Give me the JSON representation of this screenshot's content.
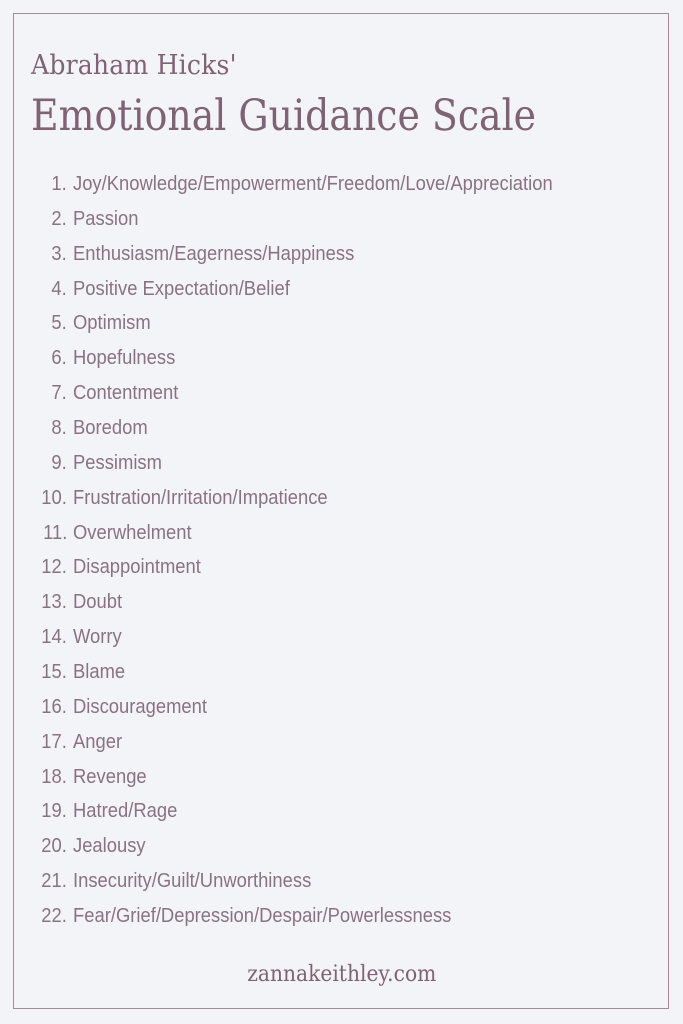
{
  "header": {
    "subtitle": "Abraham Hicks'",
    "title": "Emotional Guidance Scale"
  },
  "scale": {
    "items": [
      {
        "number": "1.",
        "label": "Joy/Knowledge/Empowerment/Freedom/Love/Appreciation"
      },
      {
        "number": "2.",
        "label": "Passion"
      },
      {
        "number": "3.",
        "label": "Enthusiasm/Eagerness/Happiness"
      },
      {
        "number": "4.",
        "label": "Positive Expectation/Belief"
      },
      {
        "number": "5.",
        "label": "Optimism"
      },
      {
        "number": "6.",
        "label": "Hopefulness"
      },
      {
        "number": "7.",
        "label": "Contentment"
      },
      {
        "number": "8.",
        "label": "Boredom"
      },
      {
        "number": "9.",
        "label": "Pessimism"
      },
      {
        "number": "10.",
        "label": "Frustration/Irritation/Impatience"
      },
      {
        "number": "11.",
        "label": "Overwhelment"
      },
      {
        "number": "12.",
        "label": "Disappointment"
      },
      {
        "number": "13.",
        "label": "Doubt"
      },
      {
        "number": "14.",
        "label": "Worry"
      },
      {
        "number": "15.",
        "label": "Blame"
      },
      {
        "number": "16.",
        "label": "Discouragement"
      },
      {
        "number": "17.",
        "label": "Anger"
      },
      {
        "number": "18.",
        "label": "Revenge"
      },
      {
        "number": "19.",
        "label": "Hatred/Rage"
      },
      {
        "number": "20.",
        "label": "Jealousy"
      },
      {
        "number": "21.",
        "label": "Insecurity/Guilt/Unworthiness"
      },
      {
        "number": "22.",
        "label": "Fear/Grief/Depression/Despair/Powerlessness"
      }
    ]
  },
  "footer": {
    "website": "zannakeithley.com"
  },
  "colors": {
    "background": "#f3f4f8",
    "border": "#a58a9b",
    "heading": "#7f6273",
    "body_text": "#8a7282"
  }
}
